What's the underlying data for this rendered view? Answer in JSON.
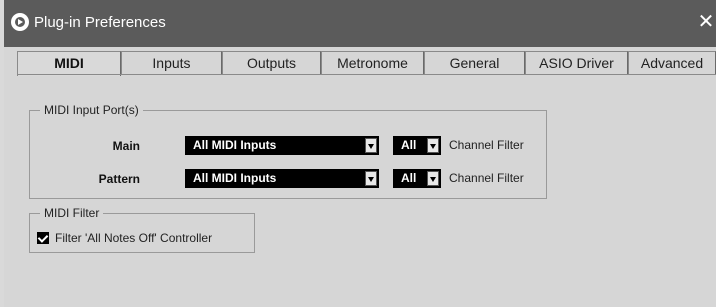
{
  "window": {
    "title": "Plug-in Preferences",
    "close_glyph": "✕"
  },
  "tabs": [
    {
      "label": "MIDI",
      "active": true
    },
    {
      "label": "Inputs",
      "active": false
    },
    {
      "label": "Outputs",
      "active": false
    },
    {
      "label": "Metronome",
      "active": false
    },
    {
      "label": "General",
      "active": false
    },
    {
      "label": "ASIO Driver",
      "active": false
    },
    {
      "label": "Advanced",
      "active": false
    }
  ],
  "midi_input_ports": {
    "group_label": "MIDI Input Port(s)",
    "rows": [
      {
        "label": "Main",
        "input_value": "All MIDI Inputs",
        "channel_value": "All",
        "channel_filter_label": "Channel Filter"
      },
      {
        "label": "Pattern",
        "input_value": "All MIDI Inputs",
        "channel_value": "All",
        "channel_filter_label": "Channel Filter"
      }
    ]
  },
  "midi_filter": {
    "group_label": "MIDI Filter",
    "checkbox_label": "Filter 'All Notes Off' Controller",
    "checked": true
  },
  "colors": {
    "titlebar": "#5b5b5b",
    "background": "#d6d6d6",
    "dropdown": "#000000"
  }
}
